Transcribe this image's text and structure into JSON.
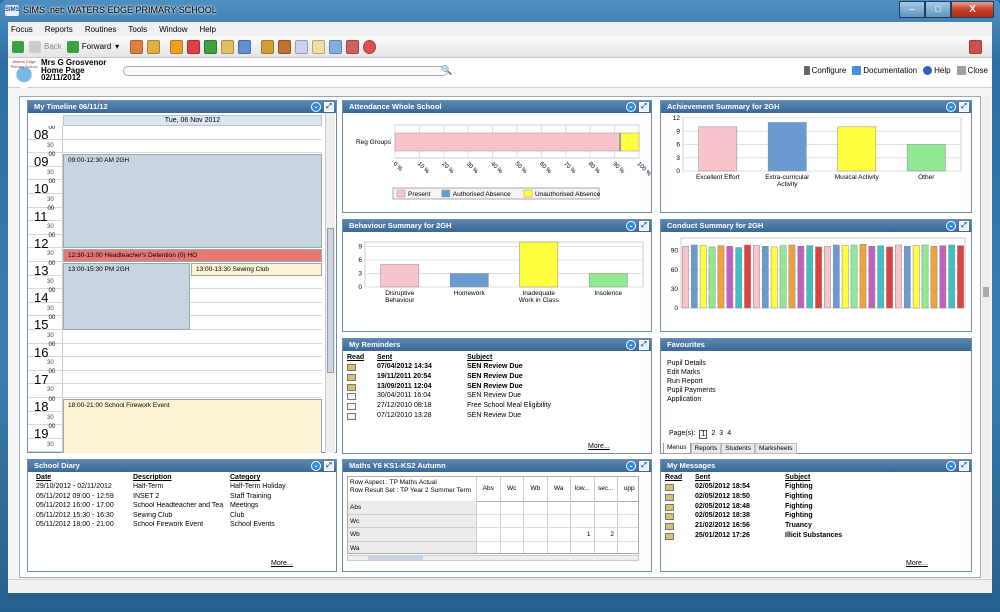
{
  "window": {
    "title": "SIMS .net: WATERS EDGE PRIMARY SCHOOL",
    "app_badge": "SIMS",
    "min": "–",
    "max": "□",
    "close": "X"
  },
  "menu": [
    "Focus",
    "Reports",
    "Routines",
    "Tools",
    "Window",
    "Help"
  ],
  "toolbar": {
    "back": "Back",
    "forward": "Forward"
  },
  "user": {
    "name": "Mrs G Grosvenor",
    "page": "Home Page",
    "date": "02/11/2012",
    "logo_text": "Waters Edge Primary School"
  },
  "links": {
    "configure": "Configure",
    "documentation": "Documentation",
    "help": "Help",
    "close": "Close"
  },
  "timeline": {
    "title": "My Timeline 06/11/12",
    "day": "Tue, 06 Nov 2012",
    "hours": [
      "08",
      "09",
      "10",
      "11",
      "12",
      "13",
      "14",
      "15",
      "16",
      "17",
      "18",
      "19"
    ],
    "min00": "00",
    "min30": "30",
    "events": [
      {
        "text": "09:00-12:30 AM 2GH"
      },
      {
        "text": "12:30-13:00 Headteacher's Detention (0) HO"
      },
      {
        "text": "13:00-15:30 PM 2GH"
      },
      {
        "text": "13:00-13:30 Sewing Club"
      },
      {
        "text": "18:00-21:00 School Firework Event"
      }
    ]
  },
  "attendance": {
    "title": "Attendance Whole School",
    "chart_data": {
      "type": "bar",
      "orientation": "horizontal",
      "stacked": true,
      "categories": [
        "Reg Groups"
      ],
      "series": [
        {
          "name": "Present",
          "values": [
            92
          ]
        },
        {
          "name": "Authorised Absence",
          "values": [
            0.5
          ]
        },
        {
          "name": "Unauthorised Absence",
          "values": [
            7.5
          ]
        }
      ],
      "xlim": [
        0,
        100
      ],
      "xticks": [
        "0 %",
        "10 %",
        "20 %",
        "30 %",
        "40 %",
        "50 %",
        "60 %",
        "70 %",
        "80 %",
        "90 %",
        "100 %"
      ],
      "colors": [
        "#f8c4cc",
        "#6a9bd0",
        "#ffff40"
      ]
    }
  },
  "achievement": {
    "title": "Achievement Summary for 2GH",
    "chart_data": {
      "type": "bar",
      "categories": [
        "Excellent Effort",
        "Extra-curricular Activity",
        "Musical Activity",
        "Other"
      ],
      "values": [
        10,
        11,
        10,
        6
      ],
      "ylim": [
        0,
        12
      ],
      "yticks": [
        "0",
        "3",
        "6",
        "9",
        "12"
      ],
      "colors": [
        "#f8c4cc",
        "#6a9bd0",
        "#ffff40",
        "#90e890"
      ]
    }
  },
  "behaviour": {
    "title": "Behaviour Summary for 2GH",
    "chart_data": {
      "type": "bar",
      "categories": [
        "Disruptive Behaviour",
        "Homework",
        "Inadequate Work in Class",
        "Insolence"
      ],
      "values": [
        5,
        3,
        10,
        3
      ],
      "ylim": [
        0,
        10
      ],
      "yticks": [
        "0",
        "3",
        "6",
        "9"
      ],
      "colors": [
        "#f8c4cc",
        "#6a9bd0",
        "#ffff40",
        "#90e890"
      ]
    }
  },
  "conduct": {
    "title": "Conduct Summary for 2GH",
    "chart_data": {
      "type": "bar",
      "values": [
        97,
        99,
        98,
        96,
        98,
        97,
        95,
        99,
        98,
        97,
        96,
        98,
        99,
        97,
        98,
        96,
        97,
        99,
        98,
        99,
        100,
        97,
        98,
        96,
        99,
        97,
        98,
        99,
        97,
        98,
        99,
        98
      ],
      "ylim": [
        0,
        110
      ],
      "yticks": [
        "0",
        "30",
        "60",
        "90"
      ],
      "colors": [
        "#f8c4cc",
        "#6a9bd0",
        "#ffff40",
        "#90e890",
        "#f0a040",
        "#c060c0",
        "#40c0c0",
        "#e04040"
      ]
    }
  },
  "reminders": {
    "title": "My Reminders",
    "headers": [
      "Read",
      "Sent",
      "Subject"
    ],
    "rows": [
      {
        "sent": "07/04/2012 14:34",
        "subject": "SEN Review Due",
        "bold": true
      },
      {
        "sent": "19/11/2011 20:54",
        "subject": "SEN Review Due",
        "bold": true
      },
      {
        "sent": "13/09/2011 12:04",
        "subject": "SEN Review Due",
        "bold": true
      },
      {
        "sent": "30/04/2011 16:04",
        "subject": "SEN Review Due",
        "bold": false
      },
      {
        "sent": "27/12/2010 08:18",
        "subject": "Free School Meal Eligibility",
        "bold": false
      },
      {
        "sent": "07/12/2010 13:28",
        "subject": "SEN Review Due",
        "bold": false
      }
    ],
    "more": "More..."
  },
  "favourites": {
    "title": "Favourites",
    "items": [
      "Pupil Details",
      "Edit Marks",
      "Run Report",
      "Pupil Payments",
      "Application"
    ],
    "pages_label": "Page(s):",
    "pages": [
      "1",
      "2",
      "3",
      "4"
    ],
    "tabs": [
      "Menus",
      "Reports",
      "Students",
      "Marksheets"
    ]
  },
  "diary": {
    "title": "School Diary",
    "headers": [
      "Date",
      "Description",
      "Category"
    ],
    "rows": [
      {
        "date": "29/10/2012 - 02/11/2012",
        "desc": "Half-Term",
        "cat": "Half-Term Holiday"
      },
      {
        "date": "05/11/2012 09:00 - 12:59",
        "desc": "INSET 2",
        "cat": "Staff Training"
      },
      {
        "date": "05/11/2012 16:00 - 17:00",
        "desc": "School Headteacher and Tea",
        "cat": "Meetings"
      },
      {
        "date": "05/11/2012 15:30 - 16:30",
        "desc": "Sewing Club",
        "cat": "Club"
      },
      {
        "date": "05/11/2012 18:00 - 21:00",
        "desc": "School Firework Event",
        "cat": "School Events"
      }
    ],
    "more": "More..."
  },
  "maths": {
    "title": "Maths Y6 KS1-KS2 Autumn",
    "aspect": "Row Aspect : TP Maths Actual",
    "resultset": "Row Result Set : TP Year 2 Summer Term",
    "cols": [
      "Abs",
      "Wc",
      "Wb",
      "Wa",
      "low...",
      "sec...",
      "upp"
    ],
    "rows": [
      {
        "label": "Abs",
        "cells": [
          "",
          "",
          "",
          "",
          "",
          "",
          ""
        ]
      },
      {
        "label": "Wc",
        "cells": [
          "",
          "",
          "",
          "",
          "",
          "",
          ""
        ]
      },
      {
        "label": "Wb",
        "cells": [
          "",
          "",
          "",
          "",
          "1",
          "2",
          ""
        ]
      },
      {
        "label": "Wa",
        "cells": [
          "",
          "",
          "",
          "",
          "",
          "",
          ""
        ]
      }
    ]
  },
  "messages": {
    "title": "My Messages",
    "headers": [
      "Read",
      "Sent",
      "Subject"
    ],
    "rows": [
      {
        "sent": "02/05/2012 18:54",
        "subject": "Fighting"
      },
      {
        "sent": "02/05/2012 18:50",
        "subject": "Fighting"
      },
      {
        "sent": "02/05/2012 18:48",
        "subject": "Fighting"
      },
      {
        "sent": "02/05/2012 18:38",
        "subject": "Fighting"
      },
      {
        "sent": "21/02/2012 16:56",
        "subject": "Truancy"
      },
      {
        "sent": "25/01/2012 17:26",
        "subject": "Illicit Substances"
      }
    ],
    "more": "More..."
  },
  "colors": {
    "accent": "#3c6896",
    "titlebar": "#2f6fa3"
  }
}
